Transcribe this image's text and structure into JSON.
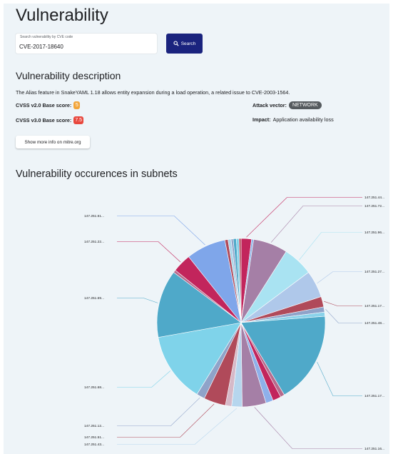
{
  "page": {
    "title": "Vulnerability"
  },
  "search": {
    "label": "Search vulnerability by CVE code",
    "value": "CVE-2017-18640",
    "button_label": "Search",
    "button_icon": "search-icon"
  },
  "description": {
    "heading": "Vulnerability description",
    "text": "The Alias feature in SnakeYAML 1.18 allows entity expansion during a load operation, a related issue to CVE-2003-1564.",
    "cvss2_label": "CVSS v2.0 Base score:",
    "cvss2_value": "5",
    "cvss3_label": "CVSS v3.0 Base score:",
    "cvss3_value": "7.5",
    "attack_vector_label": "Attack vector:",
    "attack_vector_value": "NETWORK",
    "impact_label": "Impact:",
    "impact_value": "Application availability loss",
    "more_info_button": "Show more info on mitre.org"
  },
  "colors": {
    "primary_button": "#1a237e",
    "cvss2_badge": "#f2a53a",
    "cvss3_badge": "#e8473d",
    "network_badge": "#555a5e"
  },
  "occurrences": {
    "heading": "Vulnerability occurences in subnets"
  },
  "chart_data": {
    "type": "pie",
    "title": "",
    "start_angle_deg": 0,
    "slices": [
      {
        "label": "147.251.44...",
        "value": 2.0,
        "color": "#c2255c",
        "labeled": true
      },
      {
        "label": "",
        "value": 0.4,
        "color": "#8eb8ea",
        "labeled": false
      },
      {
        "label": "147.251.72...",
        "value": 6.6,
        "color": "#a57fa6",
        "labeled": true
      },
      {
        "label": "147.251.96...",
        "value": 5.8,
        "color": "#a9e3f2",
        "labeled": true
      },
      {
        "label": "147.251.27...",
        "value": 5.2,
        "color": "#afc8ea",
        "labeled": true
      },
      {
        "label": "147.251.17...",
        "value": 2.0,
        "color": "#b04a5a",
        "labeled": true
      },
      {
        "label": "147.251.48...",
        "value": 1.0,
        "color": "#8fa3c9",
        "labeled": true
      },
      {
        "label": "",
        "value": 0.8,
        "color": "#8ad2ea",
        "labeled": false
      },
      {
        "label": "147.251.17...",
        "value": 17.6,
        "color": "#4fa9c9",
        "labeled": true
      },
      {
        "label": "",
        "value": 0.8,
        "color": "#b76a8c",
        "labeled": false
      },
      {
        "label": "",
        "value": 1.6,
        "color": "#c2255c",
        "labeled": false
      },
      {
        "label": "",
        "value": 1.4,
        "color": "#8eb0ea",
        "labeled": false
      },
      {
        "label": "147.251.16...",
        "value": 4.6,
        "color": "#a57fa6",
        "labeled": true
      },
      {
        "label": "147.251.43...",
        "value": 2.0,
        "color": "#b6d6ee",
        "labeled": true
      },
      {
        "label": "",
        "value": 1.2,
        "color": "#d6b9c8",
        "labeled": false
      },
      {
        "label": "147.251.51...",
        "value": 4.2,
        "color": "#b04a5a",
        "labeled": true
      },
      {
        "label": "147.251.12...",
        "value": 1.6,
        "color": "#8fa3c9",
        "labeled": true
      },
      {
        "label": "147.251.68...",
        "value": 13.4,
        "color": "#7fd3ea",
        "labeled": true
      },
      {
        "label": "147.251.69...",
        "value": 13.0,
        "color": "#4fa9c9",
        "labeled": true
      },
      {
        "label": "",
        "value": 0.5,
        "color": "#b76a8c",
        "labeled": false
      },
      {
        "label": "147.251.22...",
        "value": 3.6,
        "color": "#c2255c",
        "labeled": true
      },
      {
        "label": "147.251.61...",
        "value": 7.6,
        "color": "#7fa6ea",
        "labeled": true
      },
      {
        "label": "",
        "value": 0.6,
        "color": "#b04a5a",
        "labeled": false
      },
      {
        "label": "",
        "value": 0.6,
        "color": "#a9d6ea",
        "labeled": false
      },
      {
        "label": "",
        "value": 0.4,
        "color": "#8fa3c9",
        "labeled": false
      },
      {
        "label": "",
        "value": 0.6,
        "color": "#4fa9c9",
        "labeled": false
      },
      {
        "label": "",
        "value": 0.5,
        "color": "#7fd3ea",
        "labeled": false
      },
      {
        "label": "",
        "value": 0.4,
        "color": "#b04a5a",
        "labeled": false
      }
    ],
    "legend": "none"
  }
}
